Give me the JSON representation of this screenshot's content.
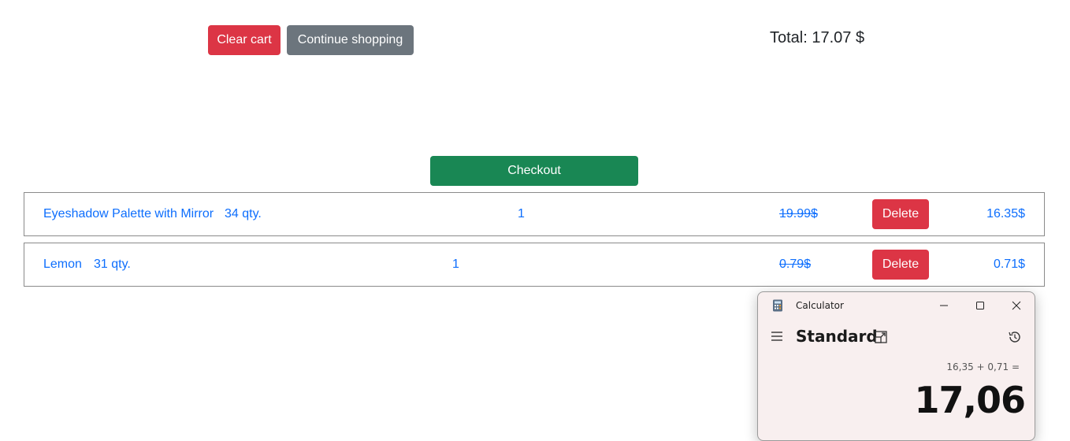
{
  "toolbar": {
    "clear_cart": "Clear cart",
    "continue_shopping": "Continue shopping",
    "total": "Total: 17.07 $"
  },
  "checkout_label": "Checkout",
  "cart_items": [
    {
      "name": "Eyeshadow Palette with Mirror",
      "stock": "34 qty.",
      "quantity": "1",
      "original_price": "19.99$",
      "delete_label": "Delete",
      "price": "16.35$"
    },
    {
      "name": "Lemon",
      "stock": "31 qty.",
      "quantity": "1",
      "original_price": "0.79$",
      "delete_label": "Delete",
      "price": "0.71$"
    }
  ],
  "calculator": {
    "window_title": "Calculator",
    "mode": "Standard",
    "expression": "16,35 + 0,71 =",
    "display": "17,06",
    "icons": [
      "calculator-app-icon",
      "minimize-icon",
      "maximize-icon",
      "close-icon",
      "hamburger-menu-icon",
      "keep-on-top-icon",
      "history-icon"
    ]
  },
  "colors": {
    "danger": "#dc3545",
    "secondary": "#6c757d",
    "success": "#198754",
    "link": "#0d6efd"
  }
}
